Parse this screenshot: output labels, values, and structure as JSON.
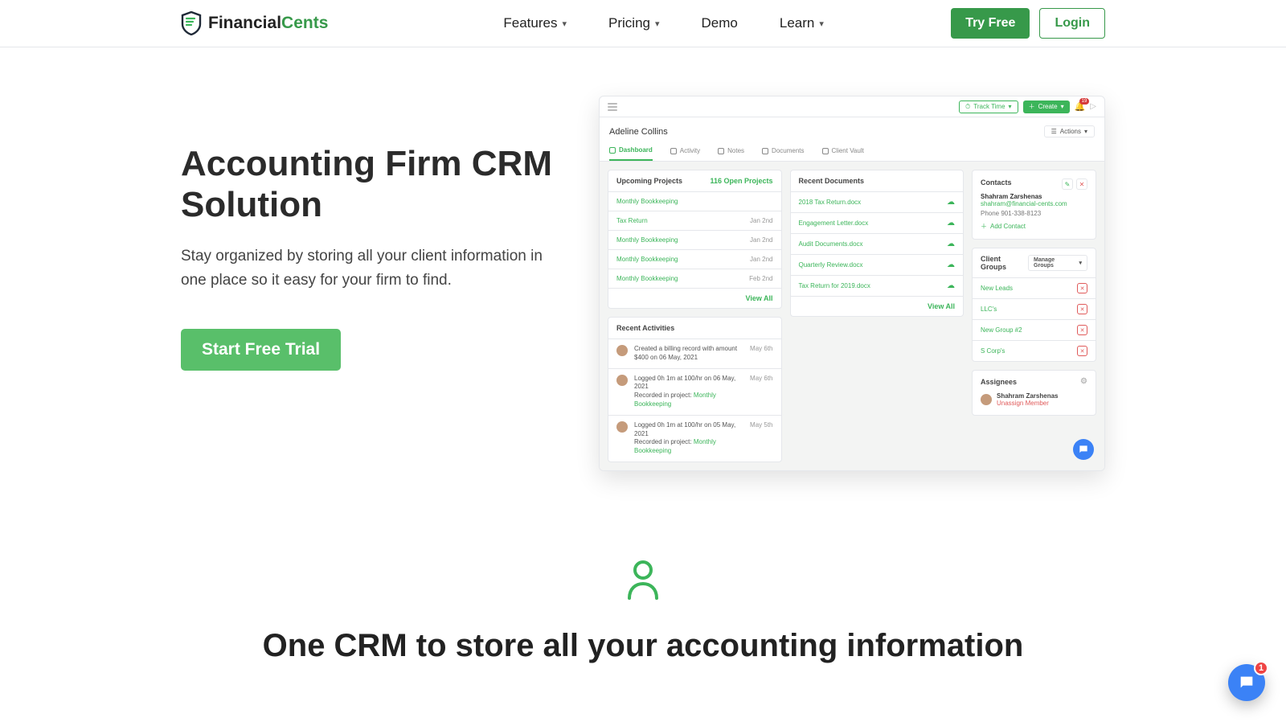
{
  "nav": {
    "brand1": "Financial",
    "brand2": "Cents",
    "items": [
      {
        "label": "Features",
        "dropdown": true
      },
      {
        "label": "Pricing",
        "dropdown": true
      },
      {
        "label": "Demo",
        "dropdown": false
      },
      {
        "label": "Learn",
        "dropdown": true
      }
    ],
    "try_free": "Try Free",
    "login": "Login"
  },
  "hero": {
    "title": "Accounting Firm CRM Solution",
    "subtitle": "Stay organized by storing all your client information in one place so it easy for your firm to find.",
    "cta": "Start Free Trial"
  },
  "app": {
    "track_time": "Track Time",
    "create": "Create",
    "notif_count": "19",
    "client": "Adeline Collins",
    "actions_label": "Actions",
    "tabs": [
      {
        "label": "Dashboard",
        "active": true
      },
      {
        "label": "Activity",
        "active": false
      },
      {
        "label": "Notes",
        "active": false
      },
      {
        "label": "Documents",
        "active": false
      },
      {
        "label": "Client Vault",
        "active": false
      }
    ],
    "upcoming": {
      "title": "Upcoming Projects",
      "open": "116 Open Projects",
      "rows": [
        {
          "name": "Monthly Bookkeeping",
          "meta": ""
        },
        {
          "name": "Tax Return",
          "meta": "Jan 2nd"
        },
        {
          "name": "Monthly Bookkeeping",
          "meta": "Jan 2nd"
        },
        {
          "name": "Monthly Bookkeeping",
          "meta": "Jan 2nd"
        },
        {
          "name": "Monthly Bookkeeping",
          "meta": "Feb 2nd"
        }
      ],
      "view_all": "View All"
    },
    "docs": {
      "title": "Recent Documents",
      "rows": [
        {
          "name": "2018 Tax Return.docx"
        },
        {
          "name": "Engagement Letter.docx"
        },
        {
          "name": "Audit Documents.docx"
        },
        {
          "name": "Quarterly Review.docx"
        },
        {
          "name": "Tax Return for 2019.docx"
        }
      ],
      "view_all": "View All"
    },
    "activities": {
      "title": "Recent Activities",
      "rows": [
        {
          "text": "Created a billing record with amount $400 on 06 May, 2021",
          "proj": "",
          "date": "May 6th"
        },
        {
          "text": "Logged 0h 1m at 100/hr on 06 May, 2021",
          "sub": "Recorded in project: ",
          "proj": "Monthly Bookkeeping",
          "date": "May 6th"
        },
        {
          "text": "Logged 0h 1m at 100/hr on 05 May, 2021",
          "sub": "Recorded in project: ",
          "proj": "Monthly Bookkeeping",
          "date": "May 5th"
        }
      ]
    },
    "contacts": {
      "title": "Contacts",
      "name": "Shahram Zarshenas",
      "email": "shahram@financial-cents.com",
      "phone": "Phone 901-338-8123",
      "add": "Add Contact"
    },
    "groups": {
      "title": "Client Groups",
      "manage": "Manage Groups",
      "rows": [
        "New Leads",
        "LLC's",
        "New Group #2",
        "S Corp's"
      ]
    },
    "assignees": {
      "title": "Assignees",
      "name": "Shahram Zarshenas",
      "unassign": "Unassign Member"
    }
  },
  "lower": {
    "heading": "One CRM to store all your accounting information"
  },
  "chat_badge": "1"
}
